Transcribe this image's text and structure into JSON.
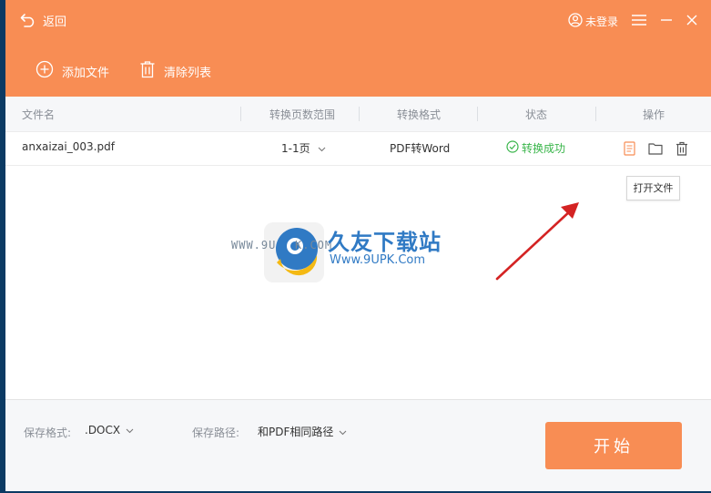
{
  "header": {
    "back_label": "返回",
    "login_label": "未登录",
    "add_file_label": "添加文件",
    "clear_list_label": "清除列表",
    "bg_color": "#f88d54"
  },
  "table": {
    "columns": [
      "文件名",
      "转换页数范围",
      "转换格式",
      "状态",
      "操作"
    ],
    "rows": [
      {
        "filename": "anxaizai_003.pdf",
        "page_range": "1-1页",
        "format": "PDF转Word",
        "status": "转换成功"
      }
    ]
  },
  "tooltip": "打开文件",
  "watermark": {
    "brand": "久友下载站",
    "url": "Www.9UPK.Com",
    "left_text": "WWW.9U",
    "left_text2": "K.COM"
  },
  "footer": {
    "save_format_label": "保存格式:",
    "save_format_value": ".DOCX",
    "save_path_label": "保存路径:",
    "save_path_value": "和PDF相同路径",
    "start_label": "开始"
  }
}
